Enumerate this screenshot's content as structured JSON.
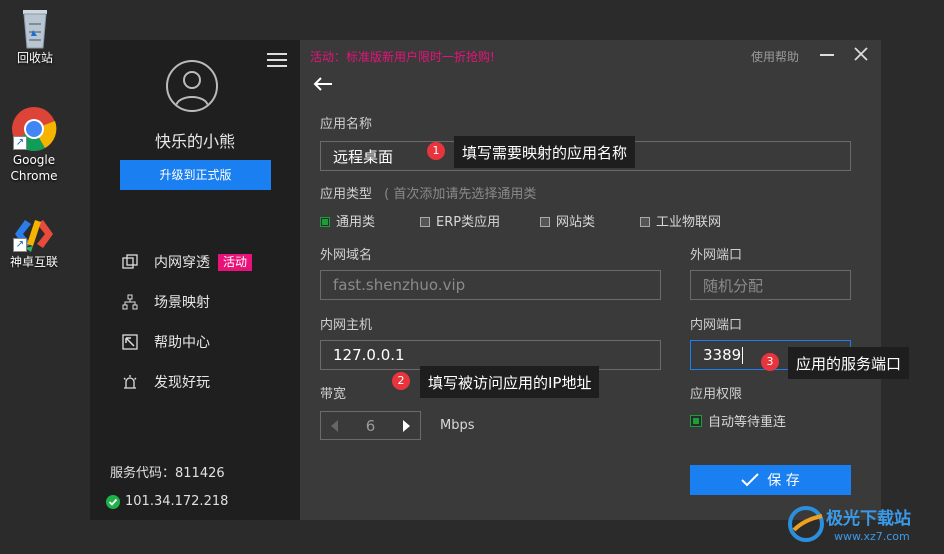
{
  "desktop": {
    "recycle_bin": "回收站",
    "chrome_line1": "Google",
    "chrome_line2": "Chrome",
    "shenzhuo": "神卓互联"
  },
  "sidebar": {
    "username": "快乐的小熊",
    "upgrade_label": "升级到正式版",
    "nav": [
      {
        "label": "内网穿透",
        "badge": "活动"
      },
      {
        "label": "场景映射"
      },
      {
        "label": "帮助中心"
      },
      {
        "label": "发现好玩"
      }
    ],
    "service_code": "服务代码：811426",
    "ip": "101.34.172.218"
  },
  "topbar": {
    "promo": "活动：标准版新用户限时一折抢购!",
    "help": "使用帮助"
  },
  "form": {
    "app_name_label": "应用名称",
    "app_name_value": "远程桌面",
    "app_type_label": "应用类型",
    "app_type_hint": "( 首次添加请先选择通用类",
    "types": [
      "通用类",
      "ERP类应用",
      "网站类",
      "工业物联网"
    ],
    "domain_label": "外网域名",
    "domain_value": "fast.shenzhuo.vip",
    "ext_port_label": "外网端口",
    "ext_port_placeholder": "随机分配",
    "host_label": "内网主机",
    "host_value": "127.0.0.1",
    "int_port_label": "内网端口",
    "int_port_value": "3389",
    "bandwidth_label": "带宽",
    "bandwidth_value": "6",
    "bandwidth_unit": "Mbps",
    "perm_label": "应用权限",
    "perm_option": "自动等待重连",
    "save_label": "保 存"
  },
  "annotations": [
    {
      "num": "1",
      "text": "填写需要映射的应用名称"
    },
    {
      "num": "2",
      "text": "填写被访问应用的IP地址"
    },
    {
      "num": "3",
      "text": "应用的服务端口"
    }
  ],
  "watermark": {
    "name": "极光下载站",
    "url": "www.xz7.com"
  },
  "colors": {
    "accent": "#1a7ff0",
    "promo": "#e8127a",
    "badge": "#e8127a",
    "check_green": "#1a9e3a",
    "annotation": "#e8343c"
  }
}
